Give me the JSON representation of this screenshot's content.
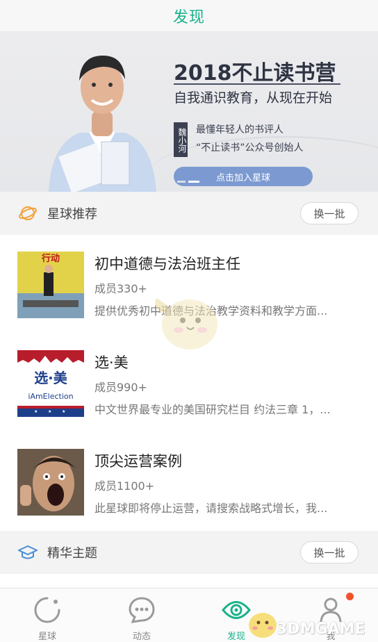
{
  "header": {
    "title": "发现"
  },
  "banner": {
    "title": "2018不止读书营",
    "subtitle": "自我通识教育，从现在开始",
    "vertical_tag": "魏小河",
    "line1": "最懂年轻人的书评人",
    "line2": "“不止读书”公众号创始人",
    "join_label": "点击加入星球"
  },
  "recommend": {
    "title": "星球推荐",
    "refresh_label": "换一批",
    "items": [
      {
        "name": "初中道德与法治班主任",
        "members": "成员330+",
        "desc": "提供优秀初中道德与法治教学资料和教学方面...",
        "thumb_text": "行动"
      },
      {
        "name": "选·美",
        "members": "成员990+",
        "desc": "中文世界最专业的美国研究栏目 约法三章 1，...",
        "thumb_text": "选·美",
        "thumb_sub": "iAmElection"
      },
      {
        "name": "顶尖运营案例",
        "members": "成员1100+",
        "desc": "此星球即将停止运营，请搜索战略式增长，我..."
      }
    ]
  },
  "featured": {
    "title": "精华主题",
    "refresh_label": "换一批"
  },
  "tabs": [
    {
      "label": "星球",
      "icon": "planet-icon",
      "active": false
    },
    {
      "label": "动态",
      "icon": "chat-icon",
      "active": false
    },
    {
      "label": "发现",
      "icon": "eye-icon",
      "active": true
    },
    {
      "label": "我",
      "icon": "person-icon",
      "active": false
    }
  ],
  "watermark": "3DMGAME",
  "colors": {
    "accent": "#19b28a",
    "badge": "#f0522a",
    "join_button": "#7c9ad1"
  }
}
